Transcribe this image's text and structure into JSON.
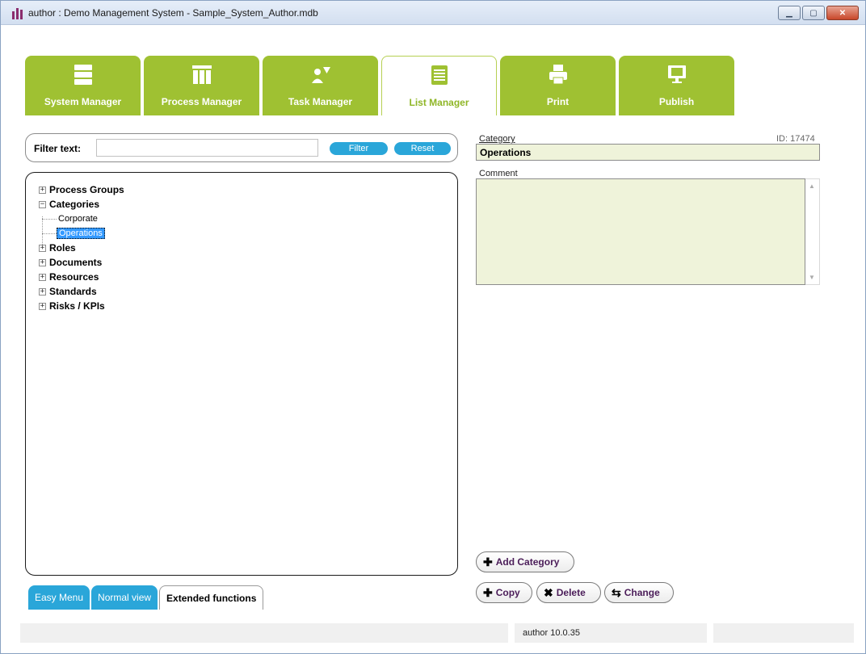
{
  "window": {
    "title": "author : Demo Management System - Sample_System_Author.mdb",
    "min_icon": "minimize-icon",
    "max_icon": "maximize-icon",
    "close_icon": "close-icon"
  },
  "tabs": [
    {
      "label": "System Manager",
      "icon": "stack-icon"
    },
    {
      "label": "Process Manager",
      "icon": "columns-icon"
    },
    {
      "label": "Task Manager",
      "icon": "person-filter-icon"
    },
    {
      "label": "List Manager",
      "icon": "list-icon"
    },
    {
      "label": "Print",
      "icon": "printer-icon"
    },
    {
      "label": "Publish",
      "icon": "monitor-icon"
    }
  ],
  "active_tab": "List Manager",
  "filter": {
    "label": "Filter text:",
    "value": "",
    "filter_button": "Filter",
    "reset_button": "Reset"
  },
  "tree": {
    "nodes": [
      {
        "label": "Process Groups",
        "expander": "+"
      },
      {
        "label": "Categories",
        "expander": "−",
        "children": [
          "Corporate",
          "Operations"
        ]
      },
      {
        "label": "Roles",
        "expander": "+"
      },
      {
        "label": "Documents",
        "expander": "+"
      },
      {
        "label": "Resources",
        "expander": "+"
      },
      {
        "label": "Standards",
        "expander": "+"
      },
      {
        "label": "Risks / KPIs",
        "expander": "+"
      }
    ],
    "selected": "Operations"
  },
  "view_tabs": [
    {
      "label": "Easy Menu"
    },
    {
      "label": "Normal view"
    },
    {
      "label": "Extended functions"
    }
  ],
  "active_view_tab": "Extended functions",
  "form": {
    "category_label": "Category",
    "id_label": "ID: 17474",
    "category_value": "Operations",
    "comment_label": "Comment",
    "comment_value": ""
  },
  "actions": {
    "add": "Add Category",
    "copy": "Copy",
    "delete": "Delete",
    "change": "Change"
  },
  "status": {
    "left": "",
    "middle": "author 10.0.35",
    "right": ""
  },
  "colors": {
    "tab_green": "#9fc132",
    "accent_blue": "#2aa6d9",
    "field_bg": "#eff3da",
    "selection_blue": "#3399ff"
  }
}
